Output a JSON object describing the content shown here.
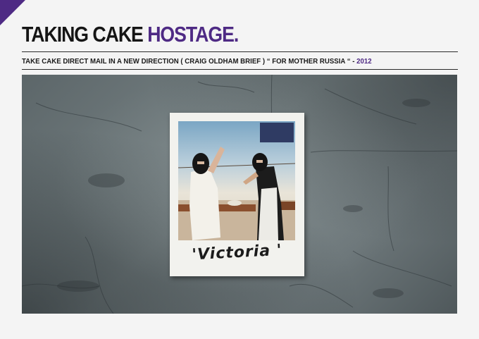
{
  "header": {
    "title_main": "TAKING CAKE",
    "title_accent": "HOSTAGE.",
    "subtitle": "TAKE CAKE DIRECT MAIL IN A NEW DIRECTION ( CRAIG OLDHAM BRIEF ) “ FOR MOTHER RUSSIA “ -",
    "year": "2012"
  },
  "photo": {
    "caption": "'Victoria '"
  },
  "colors": {
    "accent": "#4e2a84",
    "text": "#151515",
    "background": "#f4f4f4"
  }
}
